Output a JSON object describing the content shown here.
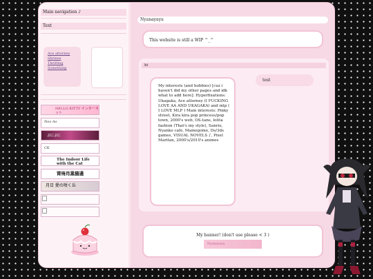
{
  "sidebar": {
    "nav_title": "Main navigation ♪",
    "nav_text": "Text",
    "nav_links": [
      "Ace attorney",
      "Shrines",
      "Thrifting",
      "Something"
    ],
    "buttons": [
      {
        "icon": "hello-kitty-button",
        "text": "HELLO KITTY  インターネット"
      },
      {
        "icon": "anime-girl-button",
        "text": "Neo Ao"
      },
      {
        "icon": "pink-dark-button",
        "text": "ぷにぷに"
      },
      {
        "icon": "ck-anime-button",
        "text": "CK"
      },
      {
        "icon": "indoor-life-button",
        "text": "The Indoor Life with the Cat"
      },
      {
        "icon": "black-cat-button",
        "text": "宵待月黒猫通"
      },
      {
        "icon": "flower-button",
        "text": "月日 愛の咲く丘"
      }
    ]
  },
  "main": {
    "title": "Nyanayayu",
    "wip": "This website is still a WIP ^_^",
    "section_title": "hi",
    "interests": "My interests (and hobbies) [cuz i haven't did my other pages and idk what to add here]: Hyperfixations: Ukagaka, Ace attorney (I FUCKING LOVE AA AND UKAGAKA) and mlp ( I LOVE MLP ) Main interests: Pinky street, Kira kira pop princess/pop town, 2000's web, OS-tans, lolita fashion (That's my style), Sanrio, Nyanko cafe, Mamegome, Ds/3ds games, VISUAL NOVELS ♪, Pixel Maritan, 2000's/2010's animes",
    "test_label": "test",
    "banner_text": "My banner! (don't use please < 3 )",
    "banner_image_text": "Nyanayayu"
  },
  "colors": {
    "background": "#101010",
    "page_pink": "#fbe6ee",
    "accent_pink": "#f2c3d5"
  }
}
